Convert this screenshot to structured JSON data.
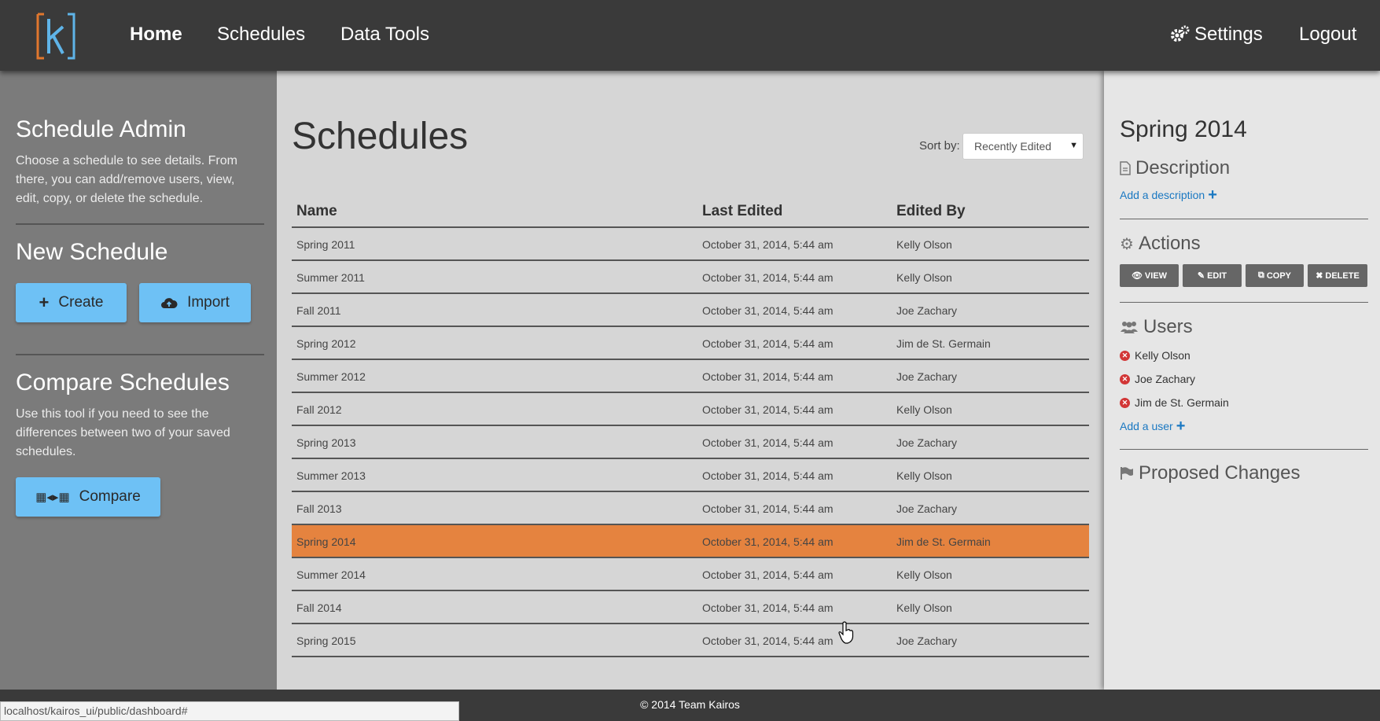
{
  "nav": {
    "home": "Home",
    "schedules": "Schedules",
    "data_tools": "Data Tools",
    "settings": "Settings",
    "logout": "Logout"
  },
  "sidebar": {
    "admin_title": "Schedule Admin",
    "admin_text": "Choose a schedule to see details. From there, you can add/remove users, view, edit, copy, or delete the schedule.",
    "new_title": "New Schedule",
    "create_label": "Create",
    "import_label": "Import",
    "compare_title": "Compare Schedules",
    "compare_text": "Use this tool if you need to see the differences between two of your saved schedules.",
    "compare_label": "Compare"
  },
  "main": {
    "title": "Schedules",
    "sort_label": "Sort by:",
    "sort_value": "Recently Edited",
    "columns": [
      "Name",
      "Last Edited",
      "Edited By"
    ],
    "rows": [
      {
        "name": "Spring 2011",
        "edited": "October 31, 2014, 5:44 am",
        "by": "Kelly Olson"
      },
      {
        "name": "Summer 2011",
        "edited": "October 31, 2014, 5:44 am",
        "by": "Kelly Olson"
      },
      {
        "name": "Fall 2011",
        "edited": "October 31, 2014, 5:44 am",
        "by": "Joe Zachary"
      },
      {
        "name": "Spring 2012",
        "edited": "October 31, 2014, 5:44 am",
        "by": "Jim de St. Germain"
      },
      {
        "name": "Summer 2012",
        "edited": "October 31, 2014, 5:44 am",
        "by": "Joe Zachary"
      },
      {
        "name": "Fall 2012",
        "edited": "October 31, 2014, 5:44 am",
        "by": "Kelly Olson"
      },
      {
        "name": "Spring 2013",
        "edited": "October 31, 2014, 5:44 am",
        "by": "Joe Zachary"
      },
      {
        "name": "Summer 2013",
        "edited": "October 31, 2014, 5:44 am",
        "by": "Kelly Olson"
      },
      {
        "name": "Fall 2013",
        "edited": "October 31, 2014, 5:44 am",
        "by": "Joe Zachary"
      },
      {
        "name": "Spring 2014",
        "edited": "October 31, 2014, 5:44 am",
        "by": "Jim de St. Germain"
      },
      {
        "name": "Summer 2014",
        "edited": "October 31, 2014, 5:44 am",
        "by": "Kelly Olson"
      },
      {
        "name": "Fall 2014",
        "edited": "October 31, 2014, 5:44 am",
        "by": "Kelly Olson"
      },
      {
        "name": "Spring 2015",
        "edited": "October 31, 2014, 5:44 am",
        "by": "Joe Zachary"
      }
    ]
  },
  "detail": {
    "title": "Spring 2014",
    "description_head": "Description",
    "add_description": "Add a description",
    "actions_head": "Actions",
    "view": "VIEW",
    "edit": "EDIT",
    "copy": "COPY",
    "delete": "DELETE",
    "users_head": "Users",
    "users": [
      "Kelly Olson",
      "Joe Zachary",
      "Jim de St. Germain"
    ],
    "add_user": "Add a user",
    "proposed_head": "Proposed Changes"
  },
  "footer": {
    "copyright": "© 2014 Team Kairos",
    "status_url": "localhost/kairos_ui/public/dashboard#"
  },
  "colors": {
    "nav_bg": "#3a3a3a",
    "sidebar_bg": "#7b7b7b",
    "accent_blue": "#6ec1f5",
    "selected_row": "#e5833f",
    "link_blue": "#1a78c2"
  }
}
